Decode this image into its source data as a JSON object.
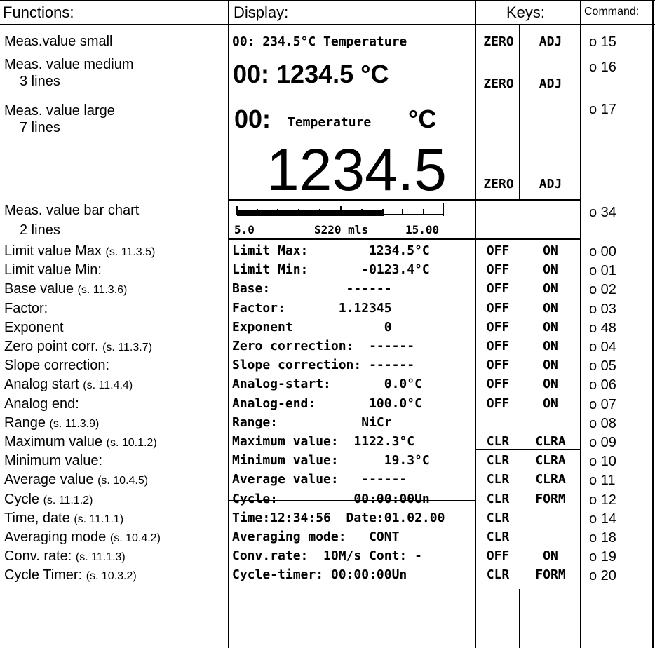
{
  "header": {
    "functions": "Functions:",
    "display": "Display:",
    "keys": "Keys:",
    "command": "Command:"
  },
  "rows": [
    {
      "fn": "Meas.value small",
      "ref": "",
      "display": "00:  234.5°C Temperature",
      "key1": "ZERO",
      "key2": "ADJ",
      "cmd": "o 15"
    },
    {
      "fn": "Meas. value medium",
      "fn2": "3 lines",
      "display": "00: 1234.5 °C",
      "key1": "ZERO",
      "key2": "ADJ",
      "cmd": "o 16"
    },
    {
      "fn": "Meas. value large",
      "fn2": "7 lines",
      "display_a": "00:",
      "display_b": "Temperature",
      "display_c": "°C",
      "display_d": "1234.5",
      "key1": "ZERO",
      "key2": "ADJ",
      "cmd": "o 17"
    },
    {
      "fn": "Meas. value bar chart",
      "fn2": "2 lines",
      "bar_left": "5.0",
      "bar_mid": "S220 mls",
      "bar_right": "15.00",
      "cmd": "o 34"
    },
    {
      "fn": "Limit value Max",
      "ref": "(s. 11.3.5)",
      "display": "Limit Max:        1234.5°C",
      "key1": "OFF",
      "key2": "ON",
      "cmd": "o 00"
    },
    {
      "fn": "Limit value Min:",
      "ref": "",
      "display": "Limit Min:       -0123.4°C",
      "key1": "OFF",
      "key2": "ON",
      "cmd": "o 01"
    },
    {
      "fn": "Base value",
      "ref": "(s. 11.3.6)",
      "display": "Base:          ------",
      "key1": "OFF",
      "key2": "ON",
      "cmd": "o 02"
    },
    {
      "fn": "Factor:",
      "ref": "",
      "display": "Factor:       1.12345",
      "key1": "OFF",
      "key2": "ON",
      "cmd": "o 03"
    },
    {
      "fn": "Exponent",
      "ref": "",
      "display": "Exponent            0",
      "key1": "OFF",
      "key2": "ON",
      "cmd": "o 48"
    },
    {
      "fn": "Zero point corr.",
      "ref": "(s. 11.3.7)",
      "display": "Zero correction:  ------",
      "key1": "OFF",
      "key2": "ON",
      "cmd": "o 04"
    },
    {
      "fn": "Slope correction:",
      "ref": "",
      "display": "Slope correction: ------",
      "key1": "OFF",
      "key2": "ON",
      "cmd": "o 05"
    },
    {
      "fn": "Analog start",
      "ref": "(s. 11.4.4)",
      "display": "Analog-start:       0.0°C",
      "key1": "OFF",
      "key2": "ON",
      "cmd": "o 06"
    },
    {
      "fn": "Analog end:",
      "ref": "",
      "display": "Analog-end:       100.0°C",
      "key1": "OFF",
      "key2": "ON",
      "cmd": "o 07"
    },
    {
      "fn": "Range",
      "ref": "(s. 11.3.9)",
      "display": "Range:           NiCr",
      "key1": "",
      "key2": "",
      "cmd": "o 08"
    },
    {
      "fn": "Maximum value",
      "ref": "(s. 10.1.2)",
      "display": "Maximum value:  1122.3°C",
      "key1": "CLR",
      "key2": "CLRA",
      "cmd": "o 09"
    },
    {
      "fn": "Minimum value:",
      "ref": "",
      "display": "Minimum value:      19.3°C",
      "key1": "CLR",
      "key2": "CLRA",
      "cmd": "o 10"
    },
    {
      "fn": "Average value",
      "ref": "(s. 10.4.5)",
      "display": "Average value:   ------",
      "key1": "CLR",
      "key2": "CLRA",
      "cmd": "o 11"
    },
    {
      "fn": "Cycle",
      "ref": "(s. 11.1.2)",
      "display": "Cycle:          00:00:00Un",
      "key1": "CLR",
      "key2": "FORM",
      "cmd": "o 12"
    },
    {
      "fn": "Time, date",
      "ref": "(s. 11.1.1)",
      "display": "Time:12:34:56  Date:01.02.00",
      "key1": "CLR",
      "key2": "",
      "cmd": "o 14"
    },
    {
      "fn": "Averaging mode",
      "ref": "(s. 10.4.2)",
      "display": "Averaging mode:   CONT",
      "key1": "CLR",
      "key2": "",
      "cmd": "o 18"
    },
    {
      "fn": "Conv. rate:",
      "ref": "(s. 11.1.3)",
      "display": "Conv.rate:  10M/s Cont: -",
      "key1": "OFF",
      "key2": "ON",
      "cmd": "o 19"
    },
    {
      "fn": "Cycle Timer:",
      "ref": "(s. 10.3.2)",
      "display": "Cycle-timer: 00:00:00Un",
      "key1": "CLR",
      "key2": "FORM",
      "cmd": "o 20"
    }
  ]
}
